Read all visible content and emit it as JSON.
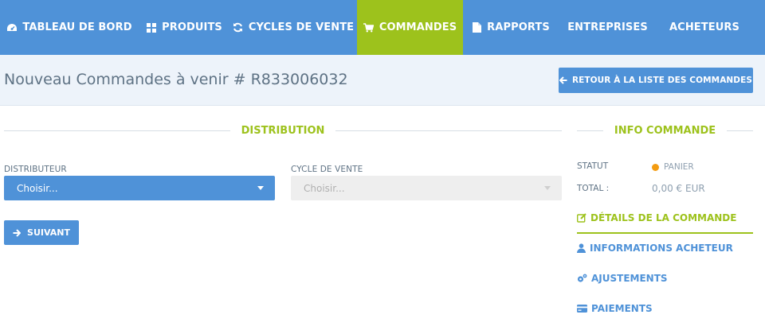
{
  "colors": {
    "nav_bg": "#4f92d8",
    "accent_green": "#9dc21c",
    "primary_blue": "#4f92d8",
    "status_orange": "#f39c12"
  },
  "nav": {
    "items": [
      {
        "label": "TABLEAU DE BORD",
        "icon": "dashboard-icon"
      },
      {
        "label": "PRODUITS",
        "icon": "grid-icon"
      },
      {
        "label": "CYCLES DE VENTE",
        "icon": "refresh-icon"
      },
      {
        "label": "COMMANDES",
        "icon": "cart-icon",
        "active": true
      },
      {
        "label": "RAPPORTS",
        "icon": "file-icon"
      },
      {
        "label": "ENTREPRISES",
        "icon": ""
      },
      {
        "label": "ACHETEURS",
        "icon": ""
      }
    ]
  },
  "header": {
    "title": "Nouveau Commandes à venir # R833006032",
    "back_label": "RETOUR À LA LISTE DES COMMANDES"
  },
  "distribution": {
    "section_title": "DISTRIBUTION",
    "distributor_label": "DISTRIBUTEUR",
    "distributor_value": "Choisir...",
    "cycle_label": "CYCLE DE VENTE",
    "cycle_value": "Choisir...",
    "next_label": "SUIVANT"
  },
  "order_info": {
    "section_title": "INFO COMMANDE",
    "status_label": "STATUT",
    "status_value": "PANIER",
    "total_label": "TOTAL :",
    "total_value": "0,00 € EUR",
    "links": [
      {
        "label": "DÉTAILS DE LA COMMANDE",
        "icon": "edit-icon",
        "active": true
      },
      {
        "label": "INFORMATIONS ACHETEUR",
        "icon": "user-icon",
        "active": false
      },
      {
        "label": "AJUSTEMENTS",
        "icon": "cogs-icon",
        "active": false
      },
      {
        "label": "PAIEMENTS",
        "icon": "credit-card-icon",
        "active": false
      }
    ]
  }
}
